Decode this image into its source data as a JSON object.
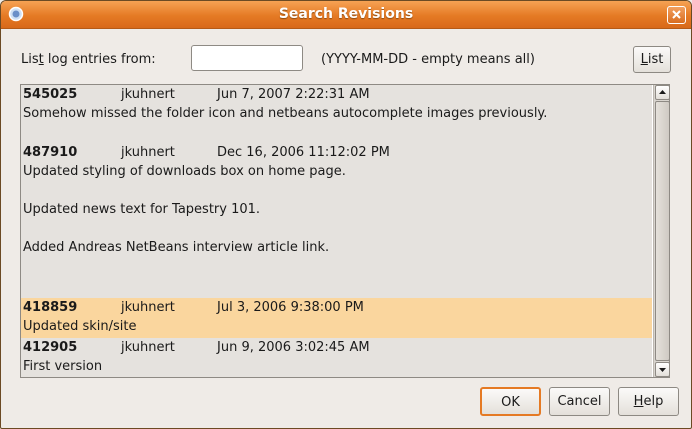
{
  "window": {
    "title": "Search Revisions"
  },
  "filter": {
    "label_before": "Lis",
    "label_mnemonic": "t",
    "label_after": " log entries from:",
    "date_value": "",
    "hint": "(YYYY-MM-DD - empty means all)",
    "list_button_mnemonic": "L",
    "list_button_rest": "ist"
  },
  "entries": [
    {
      "revision": "545025",
      "author": "jkuhnert",
      "date": "Jun 7, 2007 2:22:31 AM",
      "message_lines": [
        "Somehow missed the folder icon and netbeans autocomplete images previously."
      ]
    },
    {
      "revision": "487910",
      "author": "jkuhnert",
      "date": "Dec 16, 2006 11:12:02 PM",
      "message_lines": [
        "Updated styling of downloads box on home page.",
        "",
        "Updated news text for Tapestry 101.",
        "",
        "Added Andreas NetBeans interview article link."
      ]
    },
    {
      "revision": "418859",
      "author": "jkuhnert",
      "date": "Jul 3, 2006 9:38:00 PM",
      "message_lines": [
        "Updated skin/site"
      ],
      "selected": true
    },
    {
      "revision": "412905",
      "author": "jkuhnert",
      "date": "Jun 9, 2006 3:02:45 AM",
      "message_lines": [
        "First version"
      ]
    }
  ],
  "buttons": {
    "ok": "OK",
    "cancel": "Cancel",
    "help_mnemonic": "H",
    "help_rest": "elp"
  },
  "colors": {
    "title_bar": "#e57a24",
    "selection": "#fad69e"
  }
}
